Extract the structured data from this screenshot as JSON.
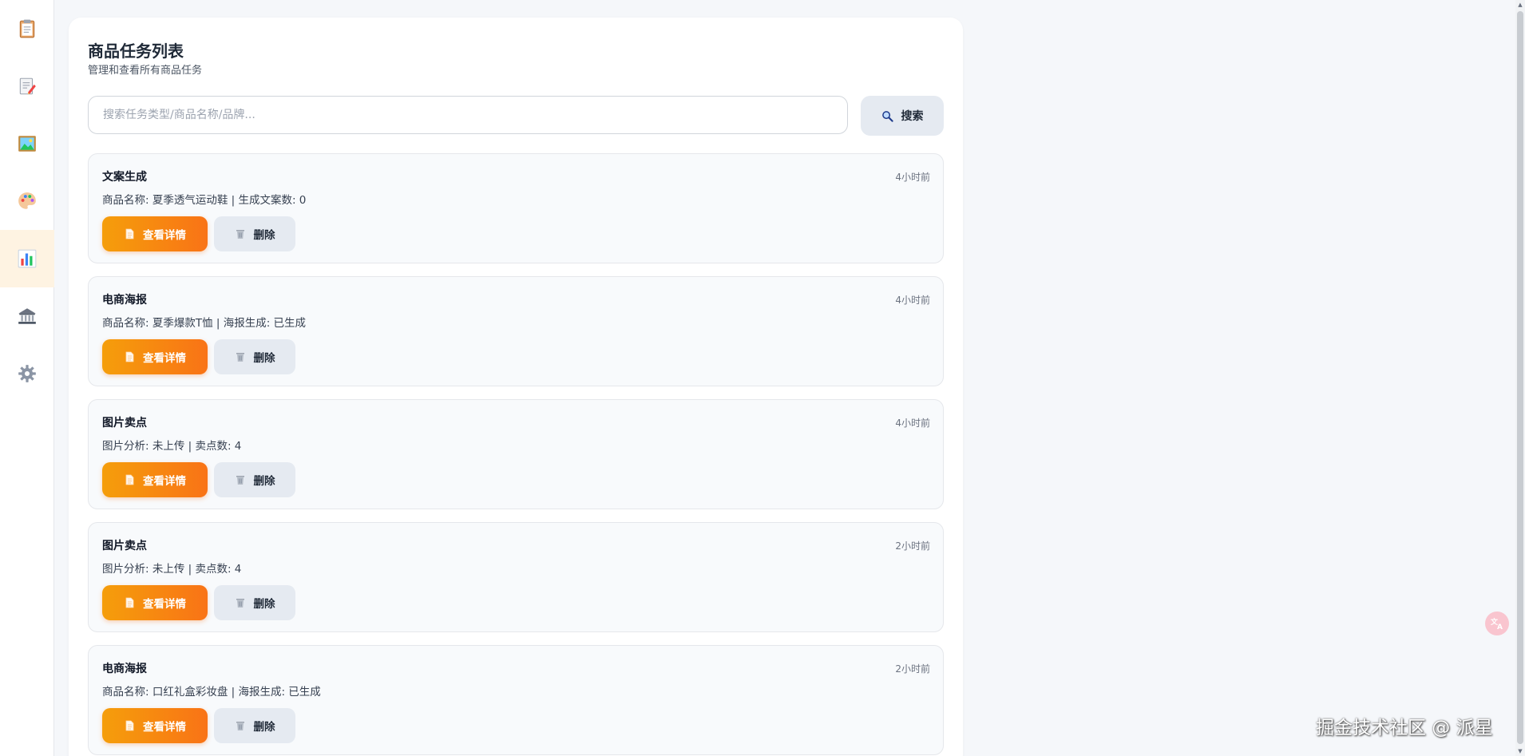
{
  "sidebar": {
    "items": [
      {
        "icon": "clipboard-icon",
        "active": false
      },
      {
        "icon": "edit-document-icon",
        "active": false
      },
      {
        "icon": "picture-icon",
        "active": false
      },
      {
        "icon": "palette-icon",
        "active": false
      },
      {
        "icon": "bar-chart-icon",
        "active": true
      },
      {
        "icon": "bank-icon",
        "active": false
      },
      {
        "icon": "gear-icon",
        "active": false
      }
    ]
  },
  "header": {
    "title": "商品任务列表",
    "subtitle": "管理和查看所有商品任务"
  },
  "search": {
    "placeholder": "搜索任务类型/商品名称/品牌...",
    "value": "",
    "button_label": "搜索"
  },
  "actions": {
    "detail_label": "查看详情",
    "delete_label": "删除"
  },
  "tasks": [
    {
      "type": "文案生成",
      "time": "4小时前",
      "desc": "商品名称: 夏季透气运动鞋 | 生成文案数: 0"
    },
    {
      "type": "电商海报",
      "time": "4小时前",
      "desc": "商品名称: 夏季爆款T恤 | 海报生成: 已生成"
    },
    {
      "type": "图片卖点",
      "time": "4小时前",
      "desc": "图片分析: 未上传 | 卖点数: 4"
    },
    {
      "type": "图片卖点",
      "time": "2小时前",
      "desc": "图片分析: 未上传 | 卖点数: 4"
    },
    {
      "type": "电商海报",
      "time": "2小时前",
      "desc": "商品名称: 口红礼盒彩妆盘 | 海报生成: 已生成"
    }
  ],
  "watermark": "掘金技术社区 @ 派星",
  "colors": {
    "accent_gradient_start": "#f59e0b",
    "accent_gradient_end": "#f97316",
    "active_nav_bg": "#fef3e2",
    "secondary_button_bg": "#e5eaf1"
  }
}
